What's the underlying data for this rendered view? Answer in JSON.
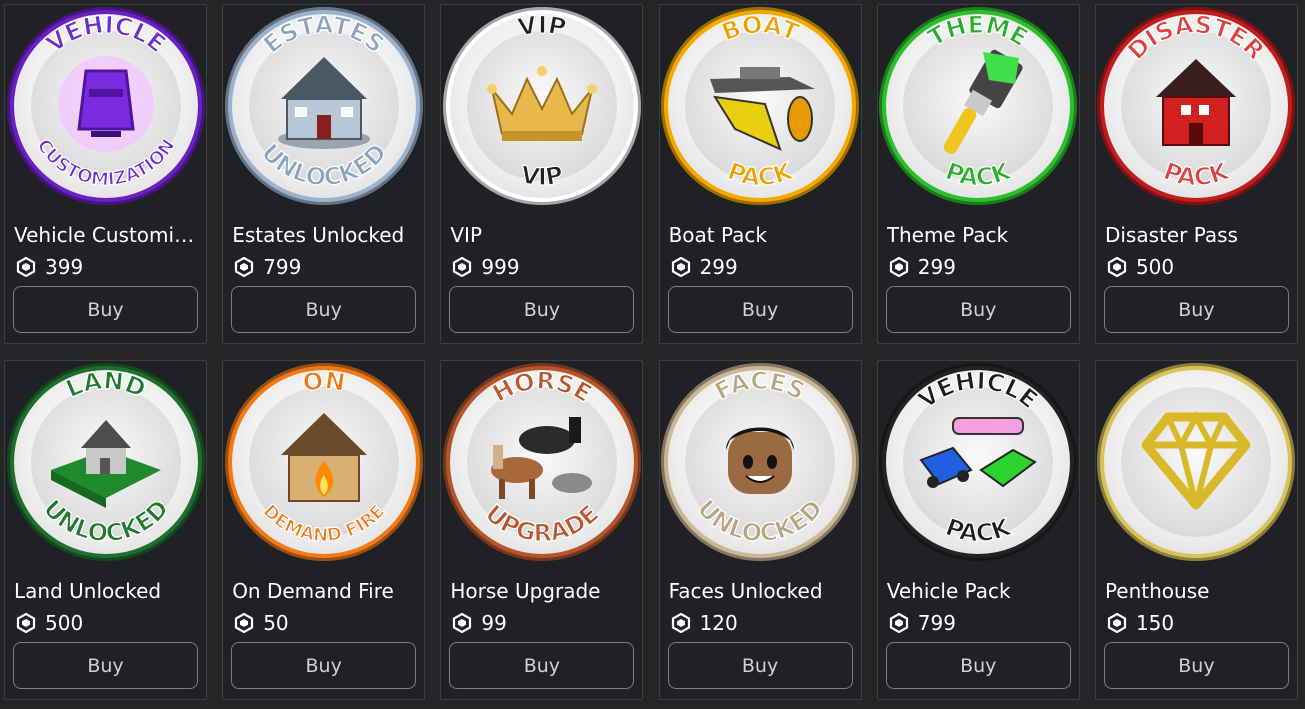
{
  "store": {
    "items": [
      {
        "name": "Vehicle Customiz...",
        "price": "399",
        "buy": "Buy",
        "icon": "vehicle-customization-badge-icon",
        "ring": "#6a1fc4",
        "top": "VEHICLE",
        "bottom": "CUSTOMIZATION",
        "text_color": "#6a2fd0"
      },
      {
        "name": "Estates Unlocked",
        "price": "799",
        "buy": "Buy",
        "icon": "estates-unlocked-badge-icon",
        "ring": "#9ab2cc",
        "top": "ESTATES",
        "bottom": "UNLOCKED",
        "text_color": "#8aa4c2"
      },
      {
        "name": "VIP",
        "price": "999",
        "buy": "Buy",
        "icon": "vip-crown-badge-icon",
        "ring": "#ffffff",
        "top": "VIP",
        "bottom": "VIP",
        "text_color": "#222222"
      },
      {
        "name": "Boat Pack",
        "price": "299",
        "buy": "Buy",
        "icon": "boat-pack-badge-icon",
        "ring": "#f5a800",
        "top": "BOAT",
        "bottom": "PACK",
        "text_color": "#f0a000"
      },
      {
        "name": "Theme Pack",
        "price": "299",
        "buy": "Buy",
        "icon": "theme-pack-brush-badge-icon",
        "ring": "#2bbf2b",
        "top": "THEME",
        "bottom": "PACK",
        "text_color": "#25b025"
      },
      {
        "name": "Disaster Pass",
        "price": "500",
        "buy": "Buy",
        "icon": "disaster-pass-badge-icon",
        "ring": "#c21c1c",
        "top": "DISASTER",
        "bottom": "PACK",
        "text_color": "#e04040"
      },
      {
        "name": "Land Unlocked",
        "price": "500",
        "buy": "Buy",
        "icon": "land-unlocked-badge-icon",
        "ring": "#1e6e2c",
        "top": "LAND",
        "bottom": "UNLOCKED",
        "text_color": "#1f7a2e"
      },
      {
        "name": "On Demand Fire",
        "price": "50",
        "buy": "Buy",
        "icon": "on-demand-fire-badge-icon",
        "ring": "#ef7a16",
        "top": "ON",
        "bottom": "DEMAND FIRE",
        "text_color": "#f07a12"
      },
      {
        "name": "Horse Upgrade",
        "price": "99",
        "buy": "Buy",
        "icon": "horse-upgrade-badge-icon",
        "ring": "#b4552b",
        "top": "HORSE",
        "bottom": "UPGRADE",
        "text_color": "#b8582e"
      },
      {
        "name": "Faces Unlocked",
        "price": "120",
        "buy": "Buy",
        "icon": "faces-unlocked-badge-icon",
        "ring": "#c9b893",
        "top": "FACES",
        "bottom": "UNLOCKED",
        "text_color": "#b8a57e"
      },
      {
        "name": "Vehicle Pack",
        "price": "799",
        "buy": "Buy",
        "icon": "vehicle-pack-badge-icon",
        "ring": "#222222",
        "top": "VEHICLE",
        "bottom": "PACK",
        "text_color": "#1c1c1c"
      },
      {
        "name": "Penthouse",
        "price": "150",
        "buy": "Buy",
        "icon": "penthouse-diamond-badge-icon",
        "ring": "#d7c35a",
        "top": "",
        "bottom": "",
        "text_color": "#c9b24a"
      }
    ]
  }
}
